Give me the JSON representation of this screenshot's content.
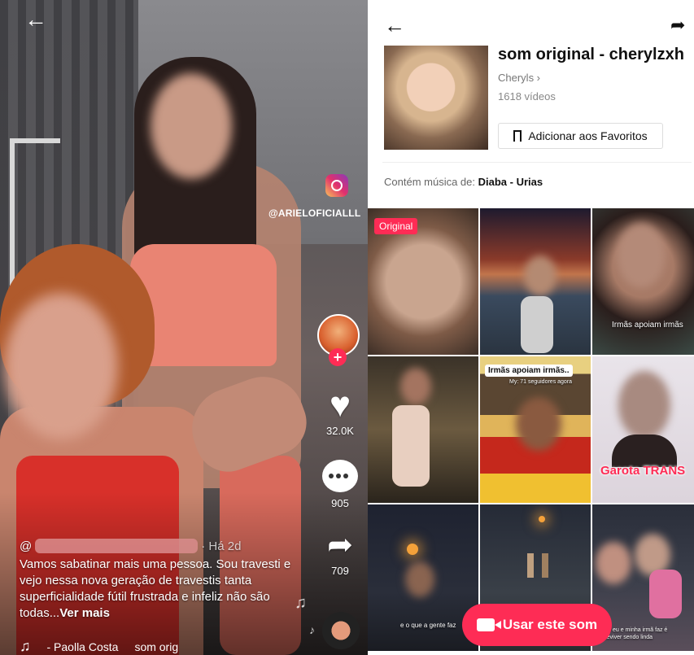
{
  "video": {
    "instagram_handle": "@ARIELOFICIALLL",
    "likes": "32.0K",
    "comments": "905",
    "shares": "709",
    "caption_time": "· Há 2d",
    "caption_prefix": "@",
    "caption_text": "Vamos sabatinar mais uma pessoa. Sou travesti e vejo nessa nova geração de travestis tanta superficialidade fútil frustrada e infeliz não são todas...",
    "caption_more": "Ver mais",
    "music_text": "- Paolla Costa",
    "music_text2": "som orig"
  },
  "sound": {
    "title": "som original - cherylzxh",
    "author": "Cheryls ›",
    "video_count": "1618 vídeos",
    "favorite_label": "Adicionar aos Favoritos",
    "contains_label": "Contém música de:",
    "contains_value": "Diaba - Urias"
  },
  "grid": {
    "original_badge": "Original",
    "tile3_text": "Irmãs apoiam irmãs",
    "tile5_label": "Irmãs apoiam irmãs..",
    "tile5_sub": "My: 71 seguidores agora",
    "tile6_text": "Garota TRANS",
    "tile7_text": "e o que a gente faz",
    "tile9_text": "O que eu e minha irmã faz é sobreviver sendo linda"
  },
  "use_button": {
    "label": "Usar este som"
  },
  "colors": {
    "accent": "#fe2c55"
  }
}
